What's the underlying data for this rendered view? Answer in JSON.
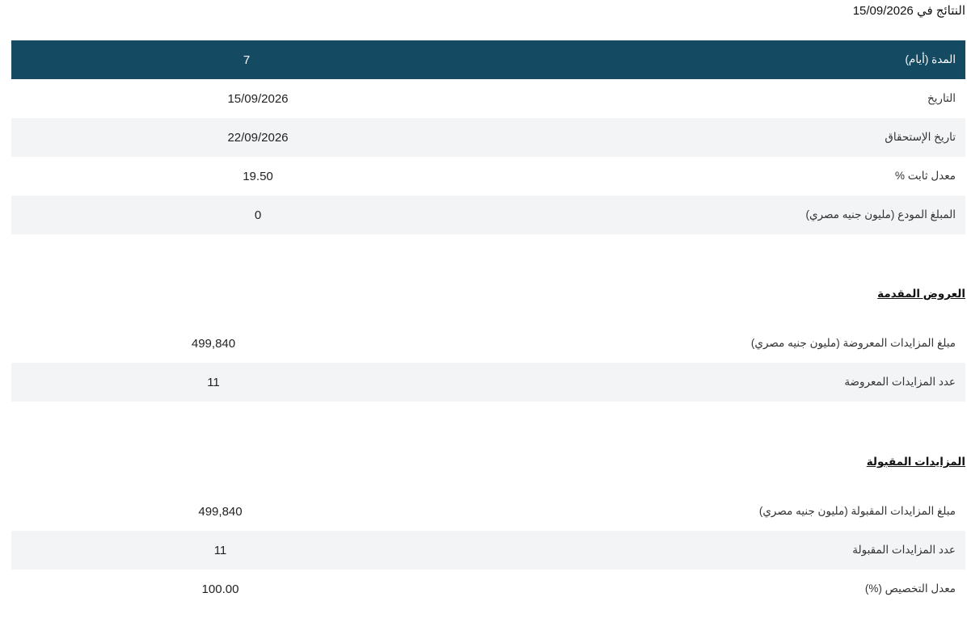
{
  "results": {
    "prefix": "النتائج في",
    "date": "15/09/2026"
  },
  "summary_table": {
    "header": {
      "label": "المدة (أيام)",
      "value": "7"
    },
    "rows": [
      {
        "label": "التاريخ",
        "value": "15/09/2026"
      },
      {
        "label": "تاريخ الإستحقاق",
        "value": "22/09/2026"
      },
      {
        "label": "معدل ثابت %",
        "value": "19.50"
      },
      {
        "label": "المبلغ المودع (مليون جنيه مصري)",
        "value": "0"
      }
    ]
  },
  "offers_section": {
    "title": "العروض المقدمة",
    "rows": [
      {
        "label": "مبلغ المزايدات المعروضة (مليون جنيه مصري)",
        "value": "499,840"
      },
      {
        "label": "عدد المزايدات المعروضة",
        "value": "11"
      }
    ]
  },
  "accepted_section": {
    "title": "المزايدات المقبولة",
    "rows": [
      {
        "label": "مبلغ المزايدات المقبولة (مليون جنيه مصري)",
        "value": "499,840"
      },
      {
        "label": "عدد المزايدات المقبولة",
        "value": "11"
      },
      {
        "label": "معدل التخصيص (%)",
        "value": "100.00"
      }
    ]
  },
  "colors": {
    "header_background": "#154a63",
    "stripe_background": "#f3f4f5"
  }
}
